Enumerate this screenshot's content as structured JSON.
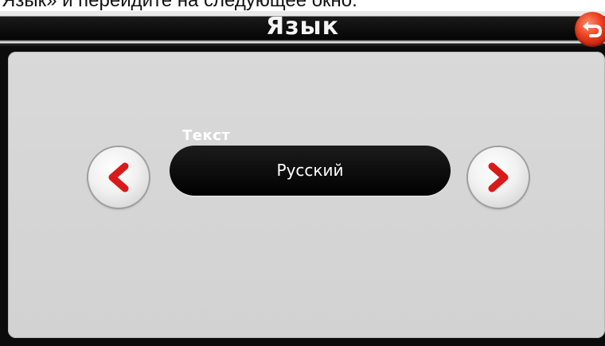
{
  "top_caption": "Язык»  и перейдите на следующее окно.",
  "window": {
    "title": "Язык"
  },
  "setting": {
    "label": "Текст",
    "value": "Русский"
  },
  "icons": {
    "back": "back-arrow-icon",
    "prev": "chevron-left-icon",
    "next": "chevron-right-icon"
  },
  "colors": {
    "accent": "#d91a1a",
    "pill": "#000000",
    "panel": "#d6d6d6"
  }
}
